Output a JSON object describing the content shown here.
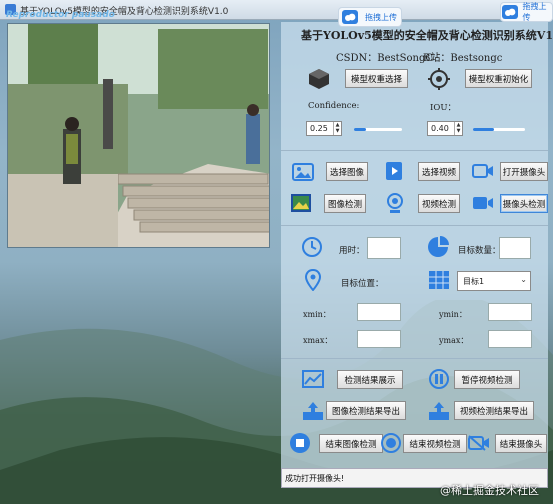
{
  "window": {
    "title": "基于YOLOv5模型的安全帽及背心检测识别系统V1.0",
    "watermark": "Reproductor pausado"
  },
  "cloud": {
    "upload_label": "拖拽上传"
  },
  "panel": {
    "title": "基于YOLOv5模型的安全帽及背心检测识别系统V1.0",
    "csdn": "CSDN：BestSongC",
    "bilibili": "B站：Bestsongc",
    "select_weights": "模型权重选择",
    "init_weights": "模型权重初始化",
    "confidence_label": "Confidence:",
    "iou_label": "IOU：",
    "confidence_value": "0.25",
    "iou_value": "0.40",
    "confidence_level": 0.25,
    "iou_level": 0.4,
    "select_image": "选择图像",
    "select_video": "选择视频",
    "open_camera": "打开摄像头",
    "image_detect": "图像检测",
    "video_detect": "视频检测",
    "camera_detect": "摄像头检测",
    "time_label": "用时：",
    "target_count_label": "目标数量：",
    "target_pos_label": "目标位置：",
    "target_select": "目标1",
    "xmin": "xmin：",
    "ymin": "ymin：",
    "xmax": "xmax：",
    "ymax": "ymax：",
    "show_results": "检测结果展示",
    "pause_video": "暂停视频检测",
    "export_image": "图像检测结果导出",
    "export_video": "视频检测结果导出",
    "end_image": "结束图像检测",
    "end_video": "结束视频检测",
    "end_camera": "结束摄像头"
  },
  "status": {
    "text": "成功打开摄像头!"
  },
  "footer": {
    "text": "@稀土掘金技术社区"
  },
  "colors": {
    "accent": "#2f7fdf",
    "panel": "#cce0ee"
  }
}
